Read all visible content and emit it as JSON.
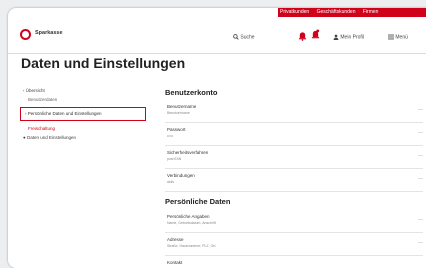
{
  "topbar": {
    "links": [
      "Privatkunden",
      "Geschäftskunden",
      "Firmen"
    ]
  },
  "header": {
    "logo_text": "Sparkasse",
    "logo_sub": "",
    "search_label": "Suche",
    "account_label": "Mein Profil",
    "menu_label": "Menü"
  },
  "page": {
    "title": "Daten und Einstellungen"
  },
  "sidebar": {
    "items": [
      {
        "label": "Übersicht"
      },
      {
        "label": "Benutzerdaten"
      },
      {
        "label": "Persönliche Daten und Einstellungen"
      },
      {
        "label": "Freischaltung"
      },
      {
        "label": "Daten und Einstellungen"
      }
    ]
  },
  "main": {
    "section1": {
      "title": "Benutzerkonto",
      "rows": [
        {
          "label": "Benutzername",
          "value": "Benutzername"
        },
        {
          "label": "Passwort",
          "value": "•••••"
        },
        {
          "label": "Sicherheitsverfahren",
          "value": "pushTAN"
        },
        {
          "label": "Verbindungen",
          "value": "aktiv"
        }
      ]
    },
    "section2": {
      "title": "Persönliche Daten",
      "rows": [
        {
          "label": "Persönliche Angaben",
          "value": "Name, Geburtsdatum, Anschrift"
        },
        {
          "label": "Adresse",
          "value": "Straße, Hausnummer, PLZ, Ort"
        },
        {
          "label": "Kontakt",
          "value": ""
        }
      ]
    }
  },
  "colors": {
    "accent": "#d0021b"
  }
}
